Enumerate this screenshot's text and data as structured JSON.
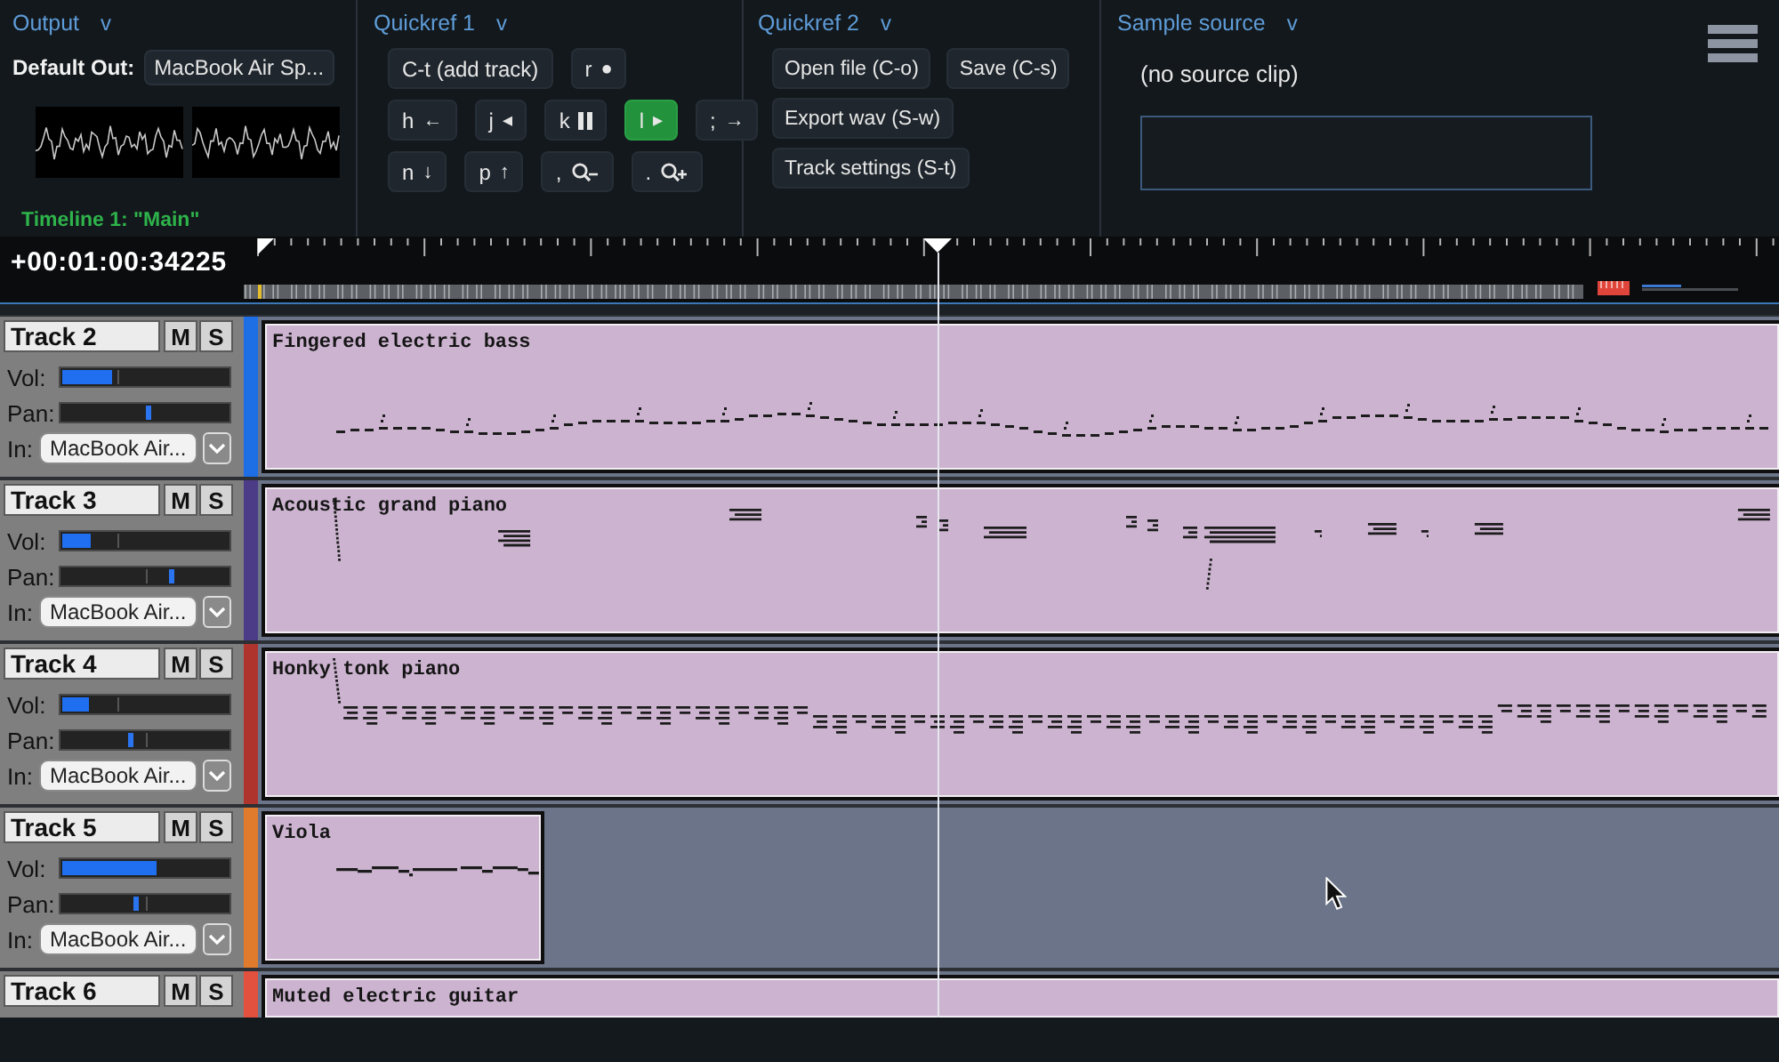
{
  "output": {
    "title": "Output",
    "toggle": "v",
    "default_out_label": "Default Out:",
    "default_out_device": "MacBook Air Sp...",
    "timeline_label": "Timeline 1: \"Main\""
  },
  "quickref_1": {
    "title": "Quickref 1",
    "toggle": "v",
    "rows": [
      [
        {
          "key": "C-t (add track)",
          "kind": "text",
          "active": false
        },
        {
          "key": "r",
          "kind": "glyph",
          "symbol": "●",
          "active": false
        }
      ],
      [
        {
          "key": "h",
          "kind": "glyph",
          "symbol": "←",
          "active": false
        },
        {
          "key": "j",
          "kind": "glyph",
          "symbol": "◂",
          "active": false
        },
        {
          "key": "k",
          "kind": "pause",
          "active": false
        },
        {
          "key": "l",
          "kind": "glyph",
          "symbol": "▸",
          "active": true
        },
        {
          "key": ";",
          "kind": "glyph",
          "symbol": "→",
          "active": false
        }
      ],
      [
        {
          "key": "n",
          "kind": "glyph",
          "symbol": "↓",
          "active": false
        },
        {
          "key": "p",
          "kind": "glyph",
          "symbol": "↑",
          "active": false
        },
        {
          "key": ",",
          "kind": "zoom-out",
          "active": false
        },
        {
          "key": ".",
          "kind": "zoom-in",
          "active": false
        }
      ]
    ]
  },
  "quickref_2": {
    "title": "Quickref 2",
    "toggle": "v",
    "rows": [
      [
        "Open file (C-o)",
        "Save (C-s)"
      ],
      [
        "Export wav (S-w)"
      ],
      [
        "Track settings (S-t)"
      ]
    ]
  },
  "sample_source": {
    "title": "Sample source",
    "toggle": "v",
    "status": "(no source clip)"
  },
  "timeline": {
    "time": "+00:01:00:34225"
  },
  "tracks": [
    {
      "name": "Track 2",
      "mute_label": "M",
      "solo_label": "S",
      "color": "#1e6fe6",
      "volume": {
        "label": "Vol:",
        "level": 0.3
      },
      "pan": {
        "label": "Pan:",
        "level": 0.52
      },
      "input": {
        "label": "In:",
        "device": "MacBook Air..."
      },
      "clips": [
        {
          "name": "Fingered electric bass",
          "open_end": true
        }
      ]
    },
    {
      "name": "Track 3",
      "mute_label": "M",
      "solo_label": "S",
      "color": "#4c3c88",
      "volume": {
        "label": "Vol:",
        "level": 0.17
      },
      "pan": {
        "label": "Pan:",
        "level": 0.66
      },
      "input": {
        "label": "In:",
        "device": "MacBook Air..."
      },
      "clips": [
        {
          "name": "Acoustic grand piano",
          "open_end": true
        }
      ]
    },
    {
      "name": "Track 4",
      "mute_label": "M",
      "solo_label": "S",
      "color": "#b0342e",
      "volume": {
        "label": "Vol:",
        "level": 0.16
      },
      "pan": {
        "label": "Pan:",
        "level": 0.41
      },
      "input": {
        "label": "In:",
        "device": "MacBook Air..."
      },
      "clips": [
        {
          "name": "Honky tonk piano",
          "open_end": true
        }
      ]
    },
    {
      "name": "Track 5",
      "mute_label": "M",
      "solo_label": "S",
      "color": "#e07b2e",
      "volume": {
        "label": "Vol:",
        "level": 0.57
      },
      "pan": {
        "label": "Pan:",
        "level": 0.44
      },
      "input": {
        "label": "In:",
        "device": "MacBook Air..."
      },
      "clips": [
        {
          "name": "Viola",
          "open_end": false
        }
      ]
    },
    {
      "name": "Track 6",
      "mute_label": "M",
      "solo_label": "S",
      "color": "#e2503e",
      "clips": [
        {
          "name": "Muted electric guitar",
          "open_end": true
        }
      ]
    }
  ]
}
